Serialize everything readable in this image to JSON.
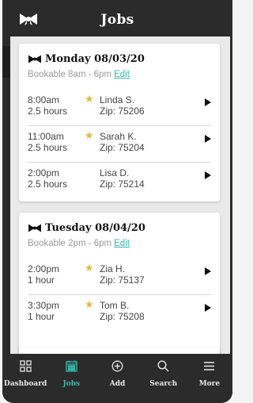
{
  "header": {
    "title": "Jobs",
    "logo_icon": "bow-icon"
  },
  "cards": [
    {
      "day": "Monday 08/03/20",
      "bookable": "Bookable 8am - 6pm",
      "edit_label": "Edit",
      "rows": [
        {
          "time": "8:00am",
          "duration": "2.5 hours",
          "starred": true,
          "name": "Linda S.",
          "zip": "Zip: 75206"
        },
        {
          "time": "11:00am",
          "duration": "2.5 hours",
          "starred": true,
          "name": "Sarah K.",
          "zip": "Zip: 75204"
        },
        {
          "time": "2:00pm",
          "duration": "2.5 hours",
          "starred": false,
          "name": "Lisa D.",
          "zip": "Zip: 75214"
        }
      ]
    },
    {
      "day": "Tuesday 08/04/20",
      "bookable": "Bookable 2pm - 6pm",
      "edit_label": "Edit",
      "rows": [
        {
          "time": "2:00pm",
          "duration": "1 hour",
          "starred": true,
          "name": "Zia H.",
          "zip": "Zip: 75137"
        },
        {
          "time": "3:30pm",
          "duration": "1 hour",
          "starred": true,
          "name": "Tom B.",
          "zip": "Zip: 75208"
        }
      ]
    }
  ],
  "nav": {
    "items": [
      {
        "label": "Dashboard",
        "icon": "grid-icon",
        "active": false
      },
      {
        "label": "Jobs",
        "icon": "calendar-icon",
        "active": true
      },
      {
        "label": "Add",
        "icon": "plus-circle-icon",
        "active": false
      },
      {
        "label": "Search",
        "icon": "search-icon",
        "active": false
      },
      {
        "label": "More",
        "icon": "menu-icon",
        "active": false
      }
    ]
  },
  "colors": {
    "accent": "#3bb6b0",
    "star": "#e2b94a",
    "chrome": "#2b2b2b"
  }
}
